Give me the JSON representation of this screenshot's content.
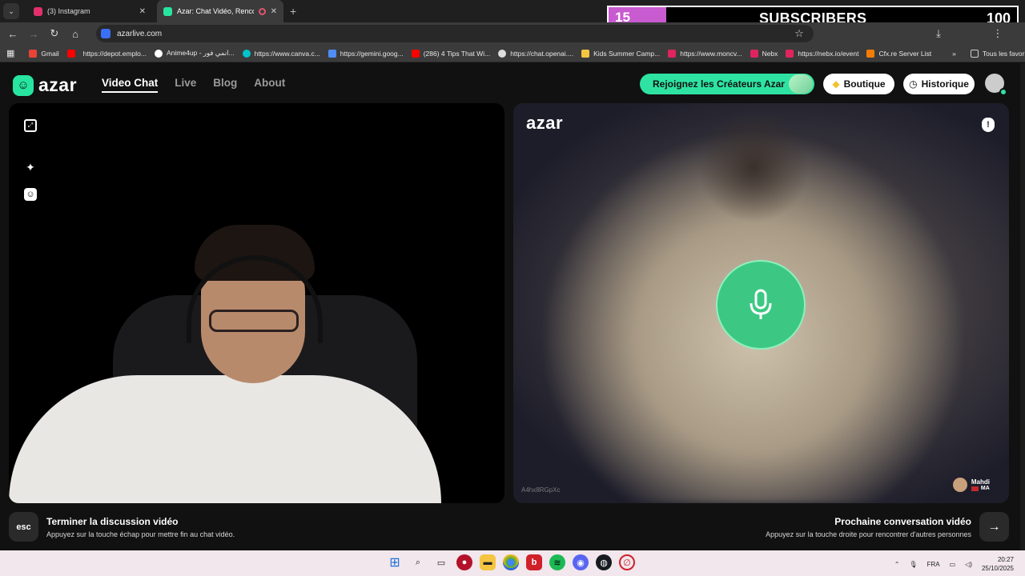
{
  "browser": {
    "tabs": [
      {
        "title": "(3) Instagram",
        "favicon_color": "#e1306c"
      },
      {
        "title": "Azar: Chat Vidéo, Rencontr",
        "favicon_color": "#27e5a0"
      }
    ],
    "url": "azarlive.com",
    "bookmarks": [
      {
        "label": "Gmail",
        "color": "#ea4335"
      },
      {
        "label": "",
        "color": "#ff0000"
      },
      {
        "label": "https://depot.emplo...",
        "color": "#888888"
      },
      {
        "label": "Anime4up - انمي فور...",
        "color": "#ffffff"
      },
      {
        "label": "https://www.canva.c...",
        "color": "#00c4cc"
      },
      {
        "label": "https://gemini.goog...",
        "color": "#4f8df7"
      },
      {
        "label": "(286) 4 Tips That Wi...",
        "color": "#ff0000"
      },
      {
        "label": "https://chat.openai....",
        "color": "#dddddd"
      },
      {
        "label": "Kids Summer Camp...",
        "color": "#f5c542"
      },
      {
        "label": "https://www.moncv...",
        "color": "#e0245e"
      },
      {
        "label": "Nebx",
        "color": "#e0245e"
      },
      {
        "label": "https://nebx.io/event",
        "color": "#e0245e"
      },
      {
        "label": "Cfx.re Server List",
        "color": "#f57c00"
      }
    ],
    "all_bookmarks_label": "Tous les favoris"
  },
  "overlay": {
    "count": "15",
    "label": "SUBSCRIBERS",
    "goal": "100",
    "count_bg": "#c95bd0"
  },
  "header": {
    "logo_text": "azar",
    "nav": [
      "Video Chat",
      "Live",
      "Blog",
      "About"
    ],
    "creators_label": "Rejoignez les Créateurs Azar",
    "shop_label": "Boutique",
    "history_label": "Historique",
    "accent": "#2ee3a2"
  },
  "right_video": {
    "watermark": "azar",
    "session_id": "A4hx8RGpXc",
    "partner_name": "Mahdi",
    "partner_country": "MA"
  },
  "footer": {
    "esc_key": "esc",
    "end_title": "Terminer la discussion vidéo",
    "end_sub": "Appuyez sur la touche échap pour mettre fin au chat vidéo.",
    "next_title": "Prochaine conversation vidéo",
    "next_sub": "Appuyez sur la touche droite pour rencontrer d'autres personnes"
  },
  "taskbar": {
    "language": "FRA",
    "time": "20:27",
    "date": "25/10/2025"
  }
}
